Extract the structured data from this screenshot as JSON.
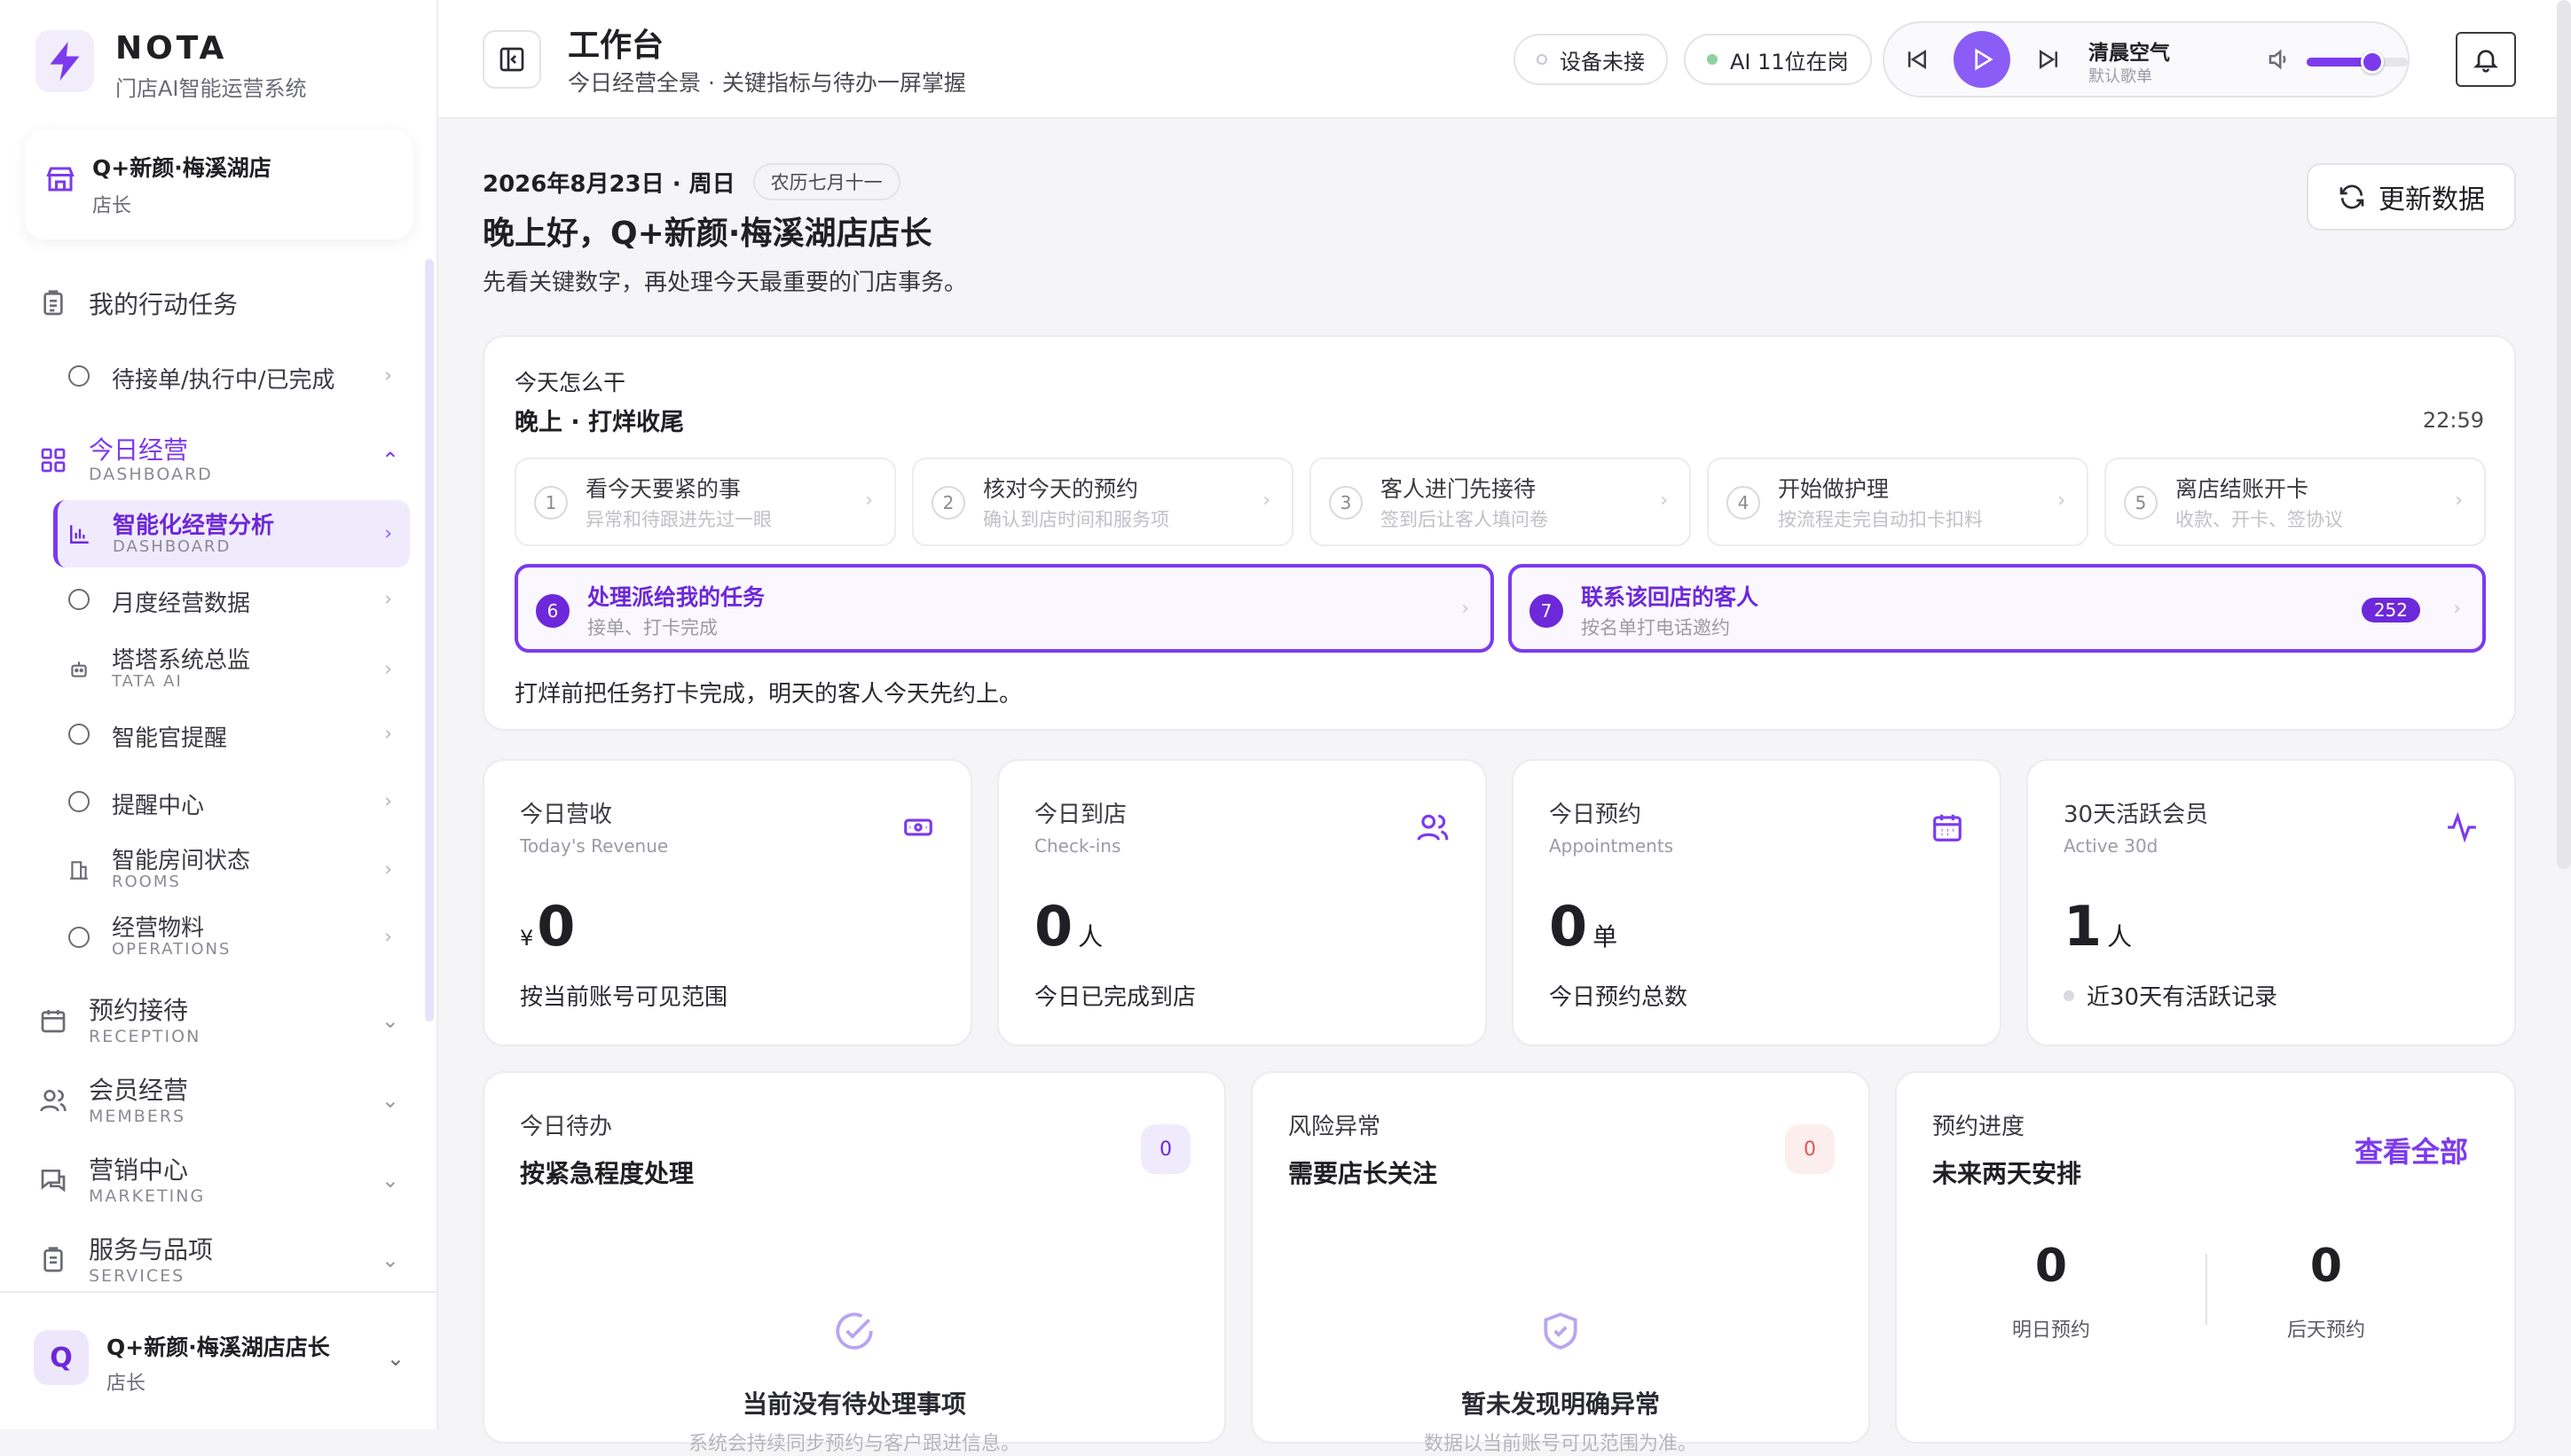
{
  "brand": {
    "name": "NOTA",
    "subtitle": "门店AI智能运营系统"
  },
  "store": {
    "name": "Q+新颜·梅溪湖店",
    "role": "店长"
  },
  "sidebar": {
    "tasks": {
      "label": "我的行动任务",
      "sub_label": "待接单/执行中/已完成"
    },
    "today": {
      "label": "今日经营",
      "en": "DASHBOARD"
    },
    "today_items": [
      {
        "label": "智能化经营分析",
        "en": "DASHBOARD"
      },
      {
        "label": "月度经营数据",
        "en": ""
      },
      {
        "label": "塔塔系统总监",
        "en": "TATA AI"
      },
      {
        "label": "智能官提醒",
        "en": ""
      },
      {
        "label": "提醒中心",
        "en": ""
      },
      {
        "label": "智能房间状态",
        "en": "ROOMS"
      },
      {
        "label": "经营物料",
        "en": "OPERATIONS"
      }
    ],
    "groups": [
      {
        "label": "预约接待",
        "en": "RECEPTION"
      },
      {
        "label": "会员经营",
        "en": "MEMBERS"
      },
      {
        "label": "营销中心",
        "en": "MARKETING"
      },
      {
        "label": "服务与品项",
        "en": "SERVICES"
      }
    ]
  },
  "user": {
    "avatar": "Q",
    "name": "Q+新颜·梅溪湖店店长",
    "role": "店长"
  },
  "header": {
    "title": "工作台",
    "subtitle": "今日经营全景 · 关键指标与待办一屏掌握",
    "device_status": "设备未接",
    "ai_status": "AI 11位在岗",
    "status_colors": {
      "device": "#c8c8d0",
      "ai": "#8fd19e"
    }
  },
  "player": {
    "song": "清晨空气",
    "playlist": "默认歌单",
    "volume": 0.65
  },
  "main": {
    "date": "2026年8月23日 · 周日",
    "lunar": "农历七月十一",
    "greeting": "晚上好，Q+新颜·梅溪湖店店长",
    "greeting_sub": "先看关键数字，再处理今天最重要的门店事务。",
    "refresh_label": "更新数据"
  },
  "plan": {
    "label": "今天怎么干",
    "title": "晚上 · 打烊收尾",
    "time": "22:59",
    "steps": [
      {
        "num": "1",
        "title": "看今天要紧的事",
        "desc": "异常和待跟进先过一眼"
      },
      {
        "num": "2",
        "title": "核对今天的预约",
        "desc": "确认到店时间和服务项"
      },
      {
        "num": "3",
        "title": "客人进门先接待",
        "desc": "签到后让客人填问卷"
      },
      {
        "num": "4",
        "title": "开始做护理",
        "desc": "按流程走完自动扣卡扣料"
      },
      {
        "num": "5",
        "title": "离店结账开卡",
        "desc": "收款、开卡、签协议"
      },
      {
        "num": "6",
        "title": "处理派给我的任务",
        "desc": "接单、打卡完成"
      },
      {
        "num": "7",
        "title": "联系该回店的客人",
        "desc": "按名单打电话邀约",
        "badge": "252"
      }
    ],
    "footer": "打烊前把任务打卡完成，明天的客人今天先约上。"
  },
  "kpis": [
    {
      "title": "今日营收",
      "en": "Today's Revenue",
      "currency": "¥",
      "value": "0",
      "unit": "",
      "foot": "按当前账号可见范围",
      "icon": "money-icon"
    },
    {
      "title": "今日到店",
      "en": "Check-ins",
      "currency": "",
      "value": "0",
      "unit": "人",
      "foot": "今日已完成到店",
      "icon": "users-icon"
    },
    {
      "title": "今日预约",
      "en": "Appointments",
      "currency": "",
      "value": "0",
      "unit": "单",
      "foot": "今日预约总数",
      "icon": "calendar-icon"
    },
    {
      "title": "30天活跃会员",
      "en": "Active 30d",
      "currency": "",
      "value": "1",
      "unit": "人",
      "foot": "近30天有活跃记录",
      "icon": "activity-icon"
    }
  ],
  "todo": {
    "title": "今日待办",
    "heading": "按紧急程度处理",
    "count": "0",
    "empty_title": "当前没有待处理事项",
    "empty_desc": "系统会持续同步预约与客户跟进信息。"
  },
  "risk": {
    "title": "风险异常",
    "heading": "需要店长关注",
    "count": "0",
    "empty_title": "暂未发现明确异常",
    "empty_desc": "数据以当前账号可见范围为准。"
  },
  "booking": {
    "title": "预约进度",
    "heading": "未来两天安排",
    "link": "查看全部",
    "tomorrow_value": "0",
    "tomorrow_label": "明日预约",
    "after_value": "0",
    "after_label": "后天预约"
  },
  "colors": {
    "accent": "#7c3aed",
    "accent_light": "#f0ebfc",
    "danger": "#e25555"
  }
}
